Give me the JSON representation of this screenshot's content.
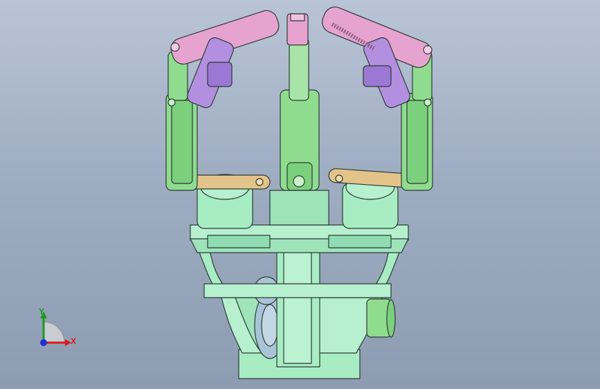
{
  "viewport": {
    "background_top": "#b9c4d6",
    "background_bottom": "#8e9cb2"
  },
  "model": {
    "description_icon": "robotic-gripper-assembly",
    "colors": {
      "base": "#a8ecc4",
      "finger_green": "#8fdc8f",
      "link_pink": "#e7a3cf",
      "link_purple": "#b38fe0",
      "link_tan": "#e2c38a",
      "motor_blue": "#a9c3d6"
    }
  },
  "triad": {
    "x_label": "X",
    "y_label": "Y",
    "x_color": "#d61c1c",
    "y_color": "#1c9a1c",
    "z_color": "#1f2fd6"
  }
}
